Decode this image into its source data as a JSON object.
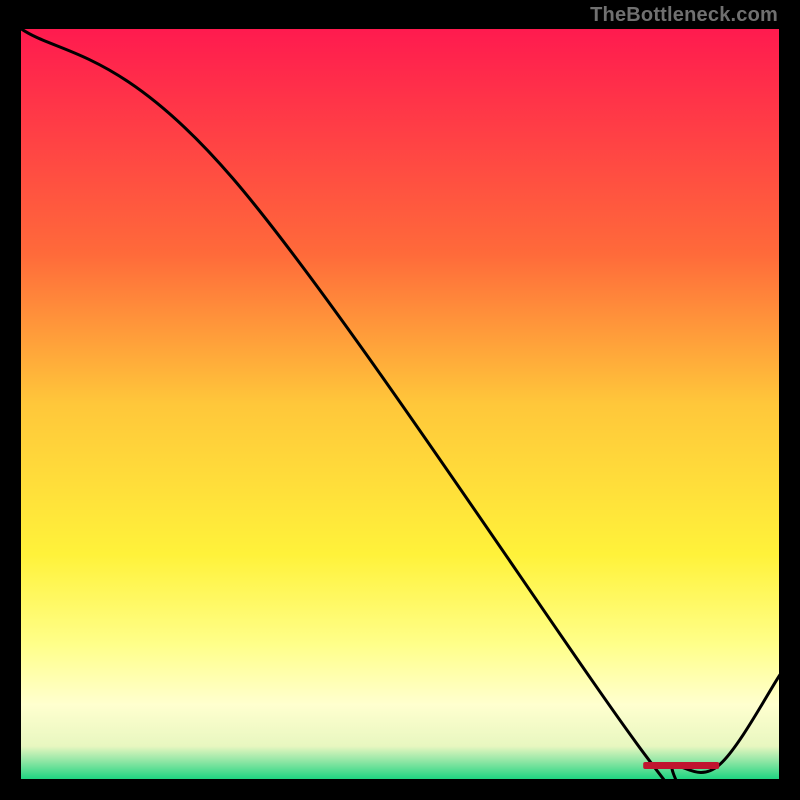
{
  "watermark": "TheBottleneck.com",
  "chart_data": {
    "type": "line",
    "title": "",
    "xlabel": "",
    "ylabel": "",
    "xlim": [
      0,
      100
    ],
    "ylim": [
      0,
      100
    ],
    "grid": false,
    "x": [
      0,
      28,
      82.5,
      86,
      92,
      100
    ],
    "values": [
      100,
      80,
      3,
      2,
      2,
      14
    ],
    "optimum_band": {
      "x_start": 82,
      "x_end": 92,
      "label": ""
    },
    "gradient_stops": [
      {
        "offset": 0.0,
        "color": "#ff1a4f"
      },
      {
        "offset": 0.3,
        "color": "#ff6a3a"
      },
      {
        "offset": 0.5,
        "color": "#ffc73a"
      },
      {
        "offset": 0.7,
        "color": "#fff23a"
      },
      {
        "offset": 0.82,
        "color": "#ffff8a"
      },
      {
        "offset": 0.9,
        "color": "#ffffcf"
      },
      {
        "offset": 0.955,
        "color": "#e8f7c0"
      },
      {
        "offset": 0.975,
        "color": "#8fe6a5"
      },
      {
        "offset": 1.0,
        "color": "#18d47f"
      }
    ]
  }
}
